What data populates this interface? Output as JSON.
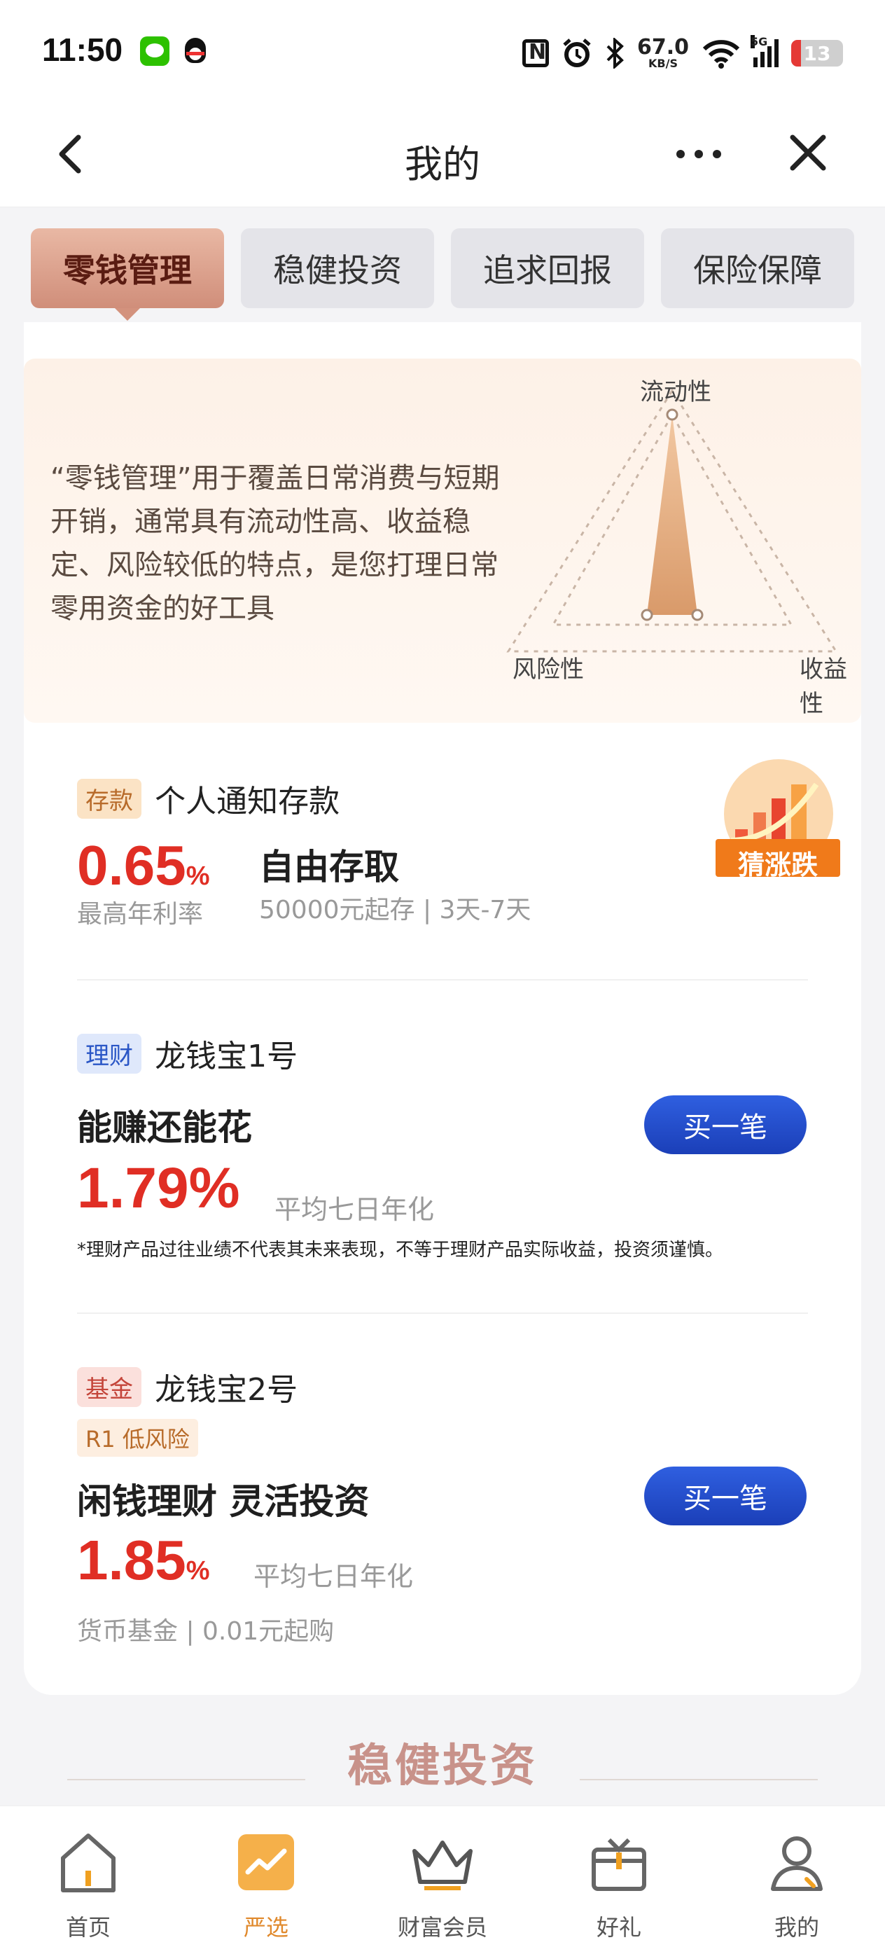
{
  "status_bar": {
    "time": "11:50",
    "net_speed": "67.0",
    "net_unit": "KB/S",
    "network": "5G",
    "battery": "13",
    "icons": [
      "wechat-icon",
      "qq-icon",
      "nfc-icon",
      "alarm-icon",
      "bluetooth-icon",
      "wifi-icon",
      "signal-icon",
      "battery-icon"
    ]
  },
  "nav": {
    "title": "我的",
    "back_icon": "chevron-left-icon",
    "more_icon": "more-dots-icon",
    "close_icon": "close-icon"
  },
  "tabs": [
    {
      "label": "零钱管理",
      "active": true
    },
    {
      "label": "稳健投资",
      "active": false
    },
    {
      "label": "追求回报",
      "active": false
    },
    {
      "label": "保险保障",
      "active": false
    }
  ],
  "intro": {
    "text": "“零钱管理”用于覆盖日常消费与短期开销，通常具有流动性高、收益稳定、风险较低的特点，是您打理日常零用资金的好工具",
    "radar_labels": {
      "top": "流动性",
      "left": "风险性",
      "right": "收益性"
    }
  },
  "products": [
    {
      "tag": "存款",
      "name": "个人通知存款",
      "rate": "0.65",
      "rate_unit": "%",
      "rate_label": "最高年利率",
      "headline": "自由存取",
      "detail": "50000元起存 | 3天-7天",
      "badge": "猜涨跌"
    },
    {
      "tag": "理财",
      "name": "龙钱宝1号",
      "headline": "能赚还能花",
      "rate": "1.79%",
      "rate_label": "平均七日年化",
      "disclaimer": "*理财产品过往业绩不代表其未来表现，不等于理财产品实际收益，投资须谨慎。",
      "button": "买一笔"
    },
    {
      "tag": "基金",
      "name": "龙钱宝2号",
      "risk": "R1 低风险",
      "headline": "闲钱理财 灵活投资",
      "rate": "1.85",
      "rate_unit": "%",
      "rate_label": "平均七日年化",
      "detail": "货币基金 | 0.01元起购",
      "button": "买一笔"
    }
  ],
  "next_section": "稳健投资",
  "bottom_nav": [
    {
      "label": "首页",
      "icon": "home-icon"
    },
    {
      "label": "严选",
      "icon": "trend-chart-icon",
      "active": true
    },
    {
      "label": "财富会员",
      "icon": "crown-icon"
    },
    {
      "label": "好礼",
      "icon": "gift-icon"
    },
    {
      "label": "我的",
      "icon": "user-icon"
    }
  ],
  "colors": {
    "rate_red": "#e02e24",
    "button_blue": "#1b3fb8",
    "tab_active": "#d08e7a",
    "accent_orange": "#e0892c"
  }
}
